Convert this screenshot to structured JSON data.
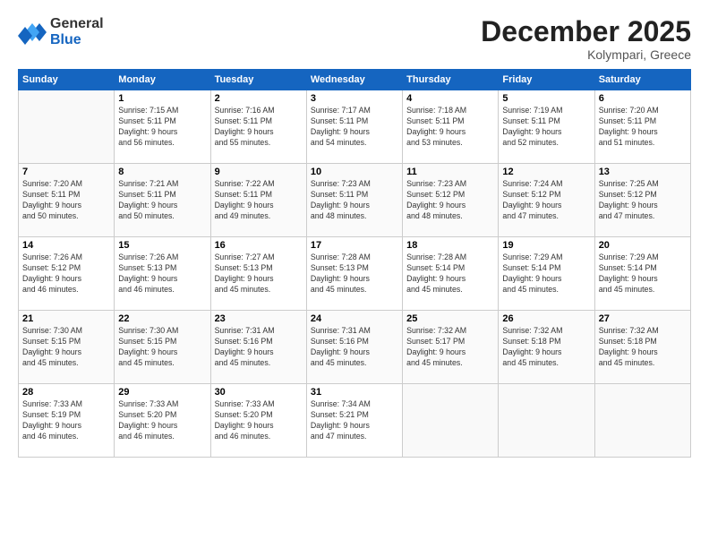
{
  "logo": {
    "line1": "General",
    "line2": "Blue"
  },
  "title": "December 2025",
  "location": "Kolympari, Greece",
  "days_of_week": [
    "Sunday",
    "Monday",
    "Tuesday",
    "Wednesday",
    "Thursday",
    "Friday",
    "Saturday"
  ],
  "weeks": [
    [
      {
        "date": "",
        "info": ""
      },
      {
        "date": "1",
        "info": "Sunrise: 7:15 AM\nSunset: 5:11 PM\nDaylight: 9 hours\nand 56 minutes."
      },
      {
        "date": "2",
        "info": "Sunrise: 7:16 AM\nSunset: 5:11 PM\nDaylight: 9 hours\nand 55 minutes."
      },
      {
        "date": "3",
        "info": "Sunrise: 7:17 AM\nSunset: 5:11 PM\nDaylight: 9 hours\nand 54 minutes."
      },
      {
        "date": "4",
        "info": "Sunrise: 7:18 AM\nSunset: 5:11 PM\nDaylight: 9 hours\nand 53 minutes."
      },
      {
        "date": "5",
        "info": "Sunrise: 7:19 AM\nSunset: 5:11 PM\nDaylight: 9 hours\nand 52 minutes."
      },
      {
        "date": "6",
        "info": "Sunrise: 7:20 AM\nSunset: 5:11 PM\nDaylight: 9 hours\nand 51 minutes."
      }
    ],
    [
      {
        "date": "7",
        "info": "Sunrise: 7:20 AM\nSunset: 5:11 PM\nDaylight: 9 hours\nand 50 minutes."
      },
      {
        "date": "8",
        "info": "Sunrise: 7:21 AM\nSunset: 5:11 PM\nDaylight: 9 hours\nand 50 minutes."
      },
      {
        "date": "9",
        "info": "Sunrise: 7:22 AM\nSunset: 5:11 PM\nDaylight: 9 hours\nand 49 minutes."
      },
      {
        "date": "10",
        "info": "Sunrise: 7:23 AM\nSunset: 5:11 PM\nDaylight: 9 hours\nand 48 minutes."
      },
      {
        "date": "11",
        "info": "Sunrise: 7:23 AM\nSunset: 5:12 PM\nDaylight: 9 hours\nand 48 minutes."
      },
      {
        "date": "12",
        "info": "Sunrise: 7:24 AM\nSunset: 5:12 PM\nDaylight: 9 hours\nand 47 minutes."
      },
      {
        "date": "13",
        "info": "Sunrise: 7:25 AM\nSunset: 5:12 PM\nDaylight: 9 hours\nand 47 minutes."
      }
    ],
    [
      {
        "date": "14",
        "info": "Sunrise: 7:26 AM\nSunset: 5:12 PM\nDaylight: 9 hours\nand 46 minutes."
      },
      {
        "date": "15",
        "info": "Sunrise: 7:26 AM\nSunset: 5:13 PM\nDaylight: 9 hours\nand 46 minutes."
      },
      {
        "date": "16",
        "info": "Sunrise: 7:27 AM\nSunset: 5:13 PM\nDaylight: 9 hours\nand 45 minutes."
      },
      {
        "date": "17",
        "info": "Sunrise: 7:28 AM\nSunset: 5:13 PM\nDaylight: 9 hours\nand 45 minutes."
      },
      {
        "date": "18",
        "info": "Sunrise: 7:28 AM\nSunset: 5:14 PM\nDaylight: 9 hours\nand 45 minutes."
      },
      {
        "date": "19",
        "info": "Sunrise: 7:29 AM\nSunset: 5:14 PM\nDaylight: 9 hours\nand 45 minutes."
      },
      {
        "date": "20",
        "info": "Sunrise: 7:29 AM\nSunset: 5:14 PM\nDaylight: 9 hours\nand 45 minutes."
      }
    ],
    [
      {
        "date": "21",
        "info": "Sunrise: 7:30 AM\nSunset: 5:15 PM\nDaylight: 9 hours\nand 45 minutes."
      },
      {
        "date": "22",
        "info": "Sunrise: 7:30 AM\nSunset: 5:15 PM\nDaylight: 9 hours\nand 45 minutes."
      },
      {
        "date": "23",
        "info": "Sunrise: 7:31 AM\nSunset: 5:16 PM\nDaylight: 9 hours\nand 45 minutes."
      },
      {
        "date": "24",
        "info": "Sunrise: 7:31 AM\nSunset: 5:16 PM\nDaylight: 9 hours\nand 45 minutes."
      },
      {
        "date": "25",
        "info": "Sunrise: 7:32 AM\nSunset: 5:17 PM\nDaylight: 9 hours\nand 45 minutes."
      },
      {
        "date": "26",
        "info": "Sunrise: 7:32 AM\nSunset: 5:18 PM\nDaylight: 9 hours\nand 45 minutes."
      },
      {
        "date": "27",
        "info": "Sunrise: 7:32 AM\nSunset: 5:18 PM\nDaylight: 9 hours\nand 45 minutes."
      }
    ],
    [
      {
        "date": "28",
        "info": "Sunrise: 7:33 AM\nSunset: 5:19 PM\nDaylight: 9 hours\nand 46 minutes."
      },
      {
        "date": "29",
        "info": "Sunrise: 7:33 AM\nSunset: 5:20 PM\nDaylight: 9 hours\nand 46 minutes."
      },
      {
        "date": "30",
        "info": "Sunrise: 7:33 AM\nSunset: 5:20 PM\nDaylight: 9 hours\nand 46 minutes."
      },
      {
        "date": "31",
        "info": "Sunrise: 7:34 AM\nSunset: 5:21 PM\nDaylight: 9 hours\nand 47 minutes."
      },
      {
        "date": "",
        "info": ""
      },
      {
        "date": "",
        "info": ""
      },
      {
        "date": "",
        "info": ""
      }
    ]
  ]
}
